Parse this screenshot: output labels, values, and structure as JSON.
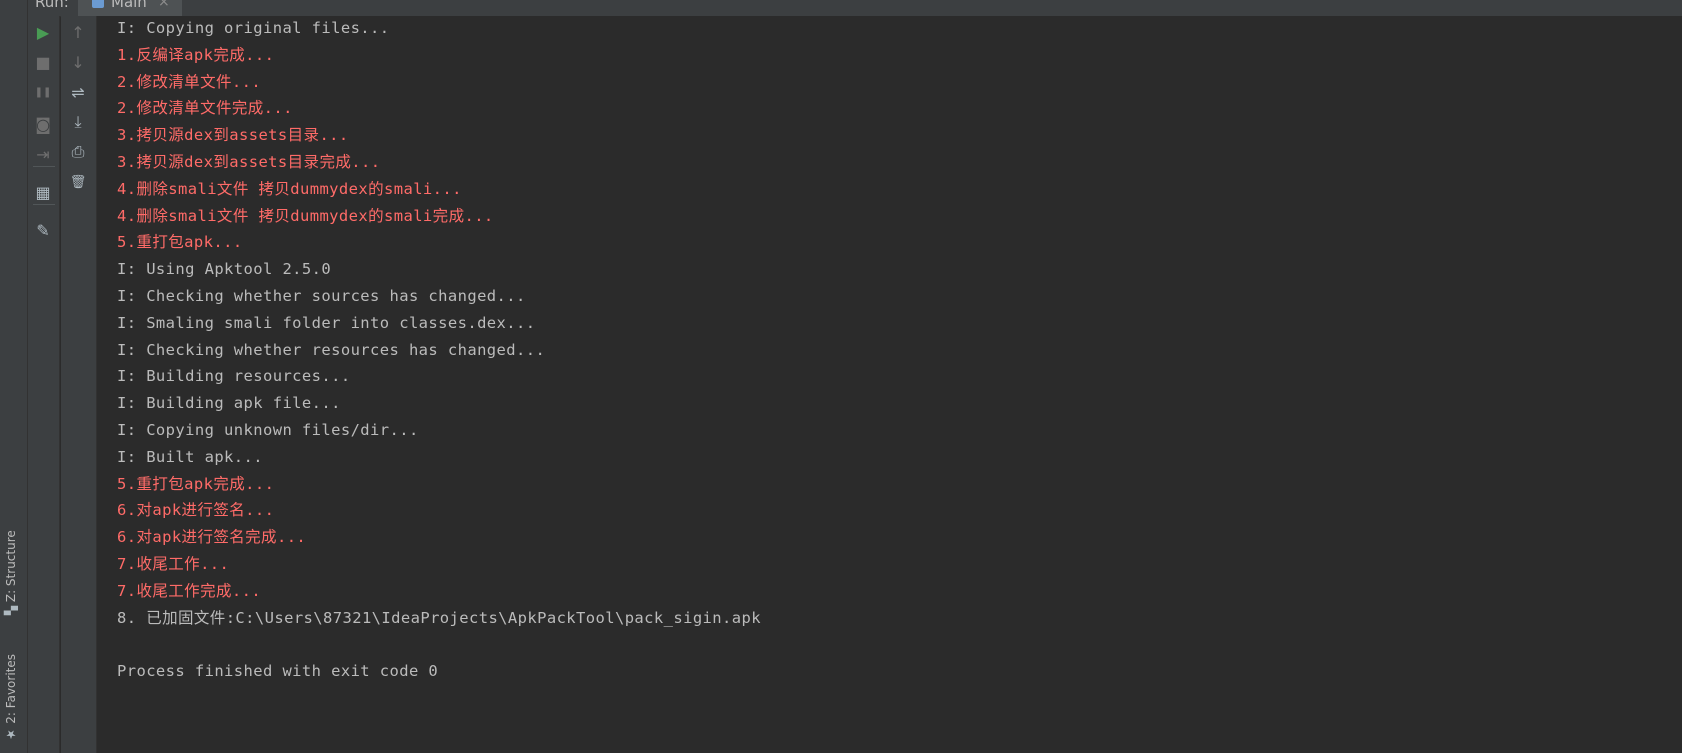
{
  "run_panel": {
    "run_label": "Run:",
    "tab_label": "Main",
    "close_glyph": "×"
  },
  "left_strip": {
    "structure_label": "Z: Structure",
    "favorites_label": "2: Favorites"
  },
  "toolbar_primary": [
    {
      "name": "rerun-icon",
      "glyph": "▶",
      "color": "#499c54"
    },
    {
      "name": "stop-icon",
      "glyph": "■",
      "color": "#6e6e6e"
    },
    {
      "name": "pause-icon",
      "glyph": "❚❚",
      "color": "#6e6e6e"
    },
    {
      "name": "camera-icon",
      "glyph": "◙",
      "color": "#6e6e6e"
    },
    {
      "name": "exit-icon",
      "glyph": "⇥",
      "color": "#6e6e6e"
    },
    {
      "name": "layout-icon",
      "glyph": "▦",
      "color": "#aeb9c0"
    },
    {
      "name": "pin-icon",
      "glyph": "✎",
      "color": "#aeb9c0"
    }
  ],
  "toolbar_secondary": [
    {
      "name": "arrow-up-icon",
      "glyph": "↑",
      "color": "#6e6e6e"
    },
    {
      "name": "arrow-down-icon",
      "glyph": "↓",
      "color": "#6e6e6e"
    },
    {
      "name": "soft-wrap-icon",
      "glyph": "⇌",
      "color": "#aeb9c0"
    },
    {
      "name": "scroll-to-end-icon",
      "glyph": "⤓",
      "color": "#aeb9c0"
    },
    {
      "name": "print-icon",
      "glyph": "⎙",
      "color": "#aeb9c0"
    },
    {
      "name": "trash-icon",
      "glyph": "🗑",
      "color": "#aeb9c0"
    }
  ],
  "console": {
    "lines": [
      {
        "text": "I: Copying original files...",
        "kind": "info"
      },
      {
        "text": "1.反编译apk完成...",
        "kind": "err"
      },
      {
        "text": "2.修改清单文件...",
        "kind": "err"
      },
      {
        "text": "2.修改清单文件完成...",
        "kind": "err"
      },
      {
        "text": "3.拷贝源dex到assets目录...",
        "kind": "err"
      },
      {
        "text": "3.拷贝源dex到assets目录完成...",
        "kind": "err"
      },
      {
        "text": "4.删除smali文件 拷贝dummydex的smali...",
        "kind": "err"
      },
      {
        "text": "4.删除smali文件 拷贝dummydex的smali完成...",
        "kind": "err"
      },
      {
        "text": "5.重打包apk...",
        "kind": "err"
      },
      {
        "text": "I: Using Apktool 2.5.0",
        "kind": "info"
      },
      {
        "text": "I: Checking whether sources has changed...",
        "kind": "info"
      },
      {
        "text": "I: Smaling smali folder into classes.dex...",
        "kind": "info"
      },
      {
        "text": "I: Checking whether resources has changed...",
        "kind": "info"
      },
      {
        "text": "I: Building resources...",
        "kind": "info"
      },
      {
        "text": "I: Building apk file...",
        "kind": "info"
      },
      {
        "text": "I: Copying unknown files/dir...",
        "kind": "info"
      },
      {
        "text": "I: Built apk...",
        "kind": "info"
      },
      {
        "text": "5.重打包apk完成...",
        "kind": "err"
      },
      {
        "text": "6.对apk进行签名...",
        "kind": "err"
      },
      {
        "text": "6.对apk进行签名完成...",
        "kind": "err"
      },
      {
        "text": "7.收尾工作...",
        "kind": "err"
      },
      {
        "text": "7.收尾工作完成...",
        "kind": "err"
      },
      {
        "text": "8. 已加固文件:C:\\Users\\87321\\IdeaProjects\\ApkPackTool\\pack_sigin.apk",
        "kind": "info"
      },
      {
        "text": "",
        "kind": "info"
      },
      {
        "text": "Process finished with exit code 0",
        "kind": "info"
      }
    ]
  },
  "colors": {
    "background": "#2b2b2b",
    "panel": "#3c3f41",
    "info_text": "#bbbbbb",
    "error_text": "#ff6b68"
  }
}
